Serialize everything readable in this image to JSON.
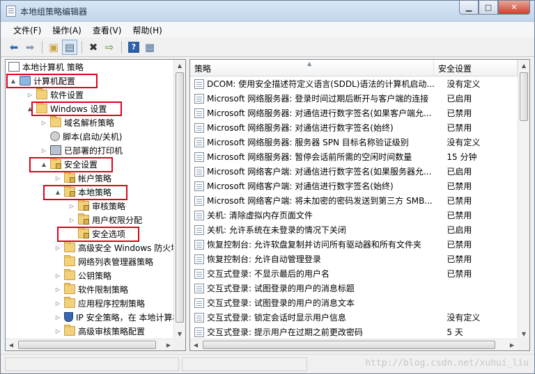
{
  "window": {
    "title": "本地组策略编辑器"
  },
  "menu": [
    "文件(F)",
    "操作(A)",
    "查看(V)",
    "帮助(H)"
  ],
  "toolbar": [
    "back-icon",
    "forward-icon",
    "up-folder-icon",
    "show-hide-tree-icon",
    "delete-icon",
    "export-icon",
    "help-icon",
    "properties-icon"
  ],
  "tree": {
    "items": [
      {
        "label": "本地计算机 策略",
        "icon": "policy",
        "expander": ""
      },
      {
        "label": "计算机配置",
        "icon": "pc",
        "expander": "▲"
      },
      {
        "label": "软件设置",
        "icon": "folder",
        "expander": "▷"
      },
      {
        "label": "Windows 设置",
        "icon": "folder",
        "expander": "▲"
      },
      {
        "label": "域名解析策略",
        "icon": "folder",
        "expander": "▷"
      },
      {
        "label": "脚本(启动/关机)",
        "icon": "doc",
        "expander": ""
      },
      {
        "label": "已部署的打印机",
        "icon": "printer",
        "expander": "▷"
      },
      {
        "label": "安全设置",
        "icon": "lockfolder",
        "expander": "▲"
      },
      {
        "label": "帐户策略",
        "icon": "lockfolder",
        "expander": "▷"
      },
      {
        "label": "本地策略",
        "icon": "lockfolder",
        "expander": "▲"
      },
      {
        "label": "审核策略",
        "icon": "lockfolder",
        "expander": "▷"
      },
      {
        "label": "用户权限分配",
        "icon": "lockfolder",
        "expander": "▷"
      },
      {
        "label": "安全选项",
        "icon": "lockfolder",
        "expander": ""
      },
      {
        "label": "高级安全 Windows 防火墙",
        "icon": "folder",
        "expander": "▷"
      },
      {
        "label": "网络列表管理器策略",
        "icon": "folder",
        "expander": ""
      },
      {
        "label": "公钥策略",
        "icon": "folder",
        "expander": "▷"
      },
      {
        "label": "软件限制策略",
        "icon": "folder",
        "expander": "▷"
      },
      {
        "label": "应用程序控制策略",
        "icon": "folder",
        "expander": "▷"
      },
      {
        "label": "IP 安全策略，在 本地计算机",
        "icon": "shield",
        "expander": "▷"
      },
      {
        "label": "高级审核策略配置",
        "icon": "folder",
        "expander": "▷"
      }
    ]
  },
  "list": {
    "columns": {
      "policy": "策略",
      "setting": "安全设置"
    },
    "rows": [
      {
        "policy": "DCOM: 使用安全描述符定义语言(SDDL)语法的计算机启动...",
        "setting": "没有定义"
      },
      {
        "policy": "Microsoft 网络服务器: 登录时间过期后断开与客户端的连接",
        "setting": "已启用"
      },
      {
        "policy": "Microsoft 网络服务器: 对通信进行数字签名(如果客户端允...",
        "setting": "已禁用"
      },
      {
        "policy": "Microsoft 网络服务器: 对通信进行数字签名(始终)",
        "setting": "已禁用"
      },
      {
        "policy": "Microsoft 网络服务器: 服务器 SPN 目标名称验证级别",
        "setting": "没有定义"
      },
      {
        "policy": "Microsoft 网络服务器: 暂停会话前所需的空闲时间数量",
        "setting": "15 分钟"
      },
      {
        "policy": "Microsoft 网络客户端: 对通信进行数字签名(如果服务器允...",
        "setting": "已启用"
      },
      {
        "policy": "Microsoft 网络客户端: 对通信进行数字签名(始终)",
        "setting": "已禁用"
      },
      {
        "policy": "Microsoft 网络客户端: 将未加密的密码发送到第三方 SMB...",
        "setting": "已禁用"
      },
      {
        "policy": "关机: 清除虚拟内存页面文件",
        "setting": "已禁用"
      },
      {
        "policy": "关机: 允许系统在未登录的情况下关闭",
        "setting": "已启用"
      },
      {
        "policy": "恢复控制台: 允许软盘复制并访问所有驱动器和所有文件夹",
        "setting": "已禁用"
      },
      {
        "policy": "恢复控制台: 允许自动管理登录",
        "setting": "已禁用"
      },
      {
        "policy": "交互式登录: 不显示最后的用户名",
        "setting": "已禁用"
      },
      {
        "policy": "交互式登录: 试图登录的用户的消息标题",
        "setting": ""
      },
      {
        "policy": "交互式登录: 试图登录的用户的消息文本",
        "setting": ""
      },
      {
        "policy": "交互式登录: 锁定会话时显示用户信息",
        "setting": "没有定义"
      },
      {
        "policy": "交互式登录: 提示用户在过期之前更改密码",
        "setting": "5 天"
      }
    ]
  },
  "status": {
    "watermark": "http://blog.csdn.net/xuhui_liu"
  },
  "colors": {
    "highlight": "#e0001b",
    "titlebar": "#c3d6ec"
  }
}
